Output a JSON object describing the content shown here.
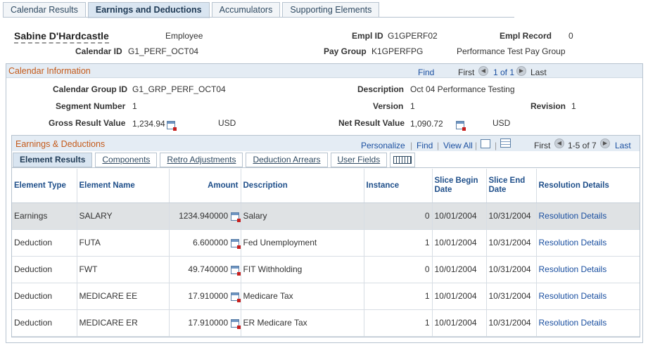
{
  "tabs": [
    "Calendar Results",
    "Earnings and Deductions",
    "Accumulators",
    "Supporting Elements"
  ],
  "header": {
    "employee_name": "Sabine D'Hardcastle",
    "employee_label": "Employee",
    "empl_id_label": "Empl ID",
    "empl_id": "G1GPERF02",
    "empl_record_label": "Empl Record",
    "empl_record": "0",
    "calendar_id_label": "Calendar ID",
    "calendar_id": "G1_PERF_OCT04",
    "pay_group_label": "Pay Group",
    "pay_group": "K1GPERFPG",
    "pay_group_desc": "Performance Test Pay Group"
  },
  "calendar_info": {
    "title": "Calendar Information",
    "find": "Find",
    "first": "First",
    "range": "1 of 1",
    "last": "Last",
    "calendar_group_id_label": "Calendar Group ID",
    "calendar_group_id": "G1_GRP_PERF_OCT04",
    "description_label": "Description",
    "description": "Oct 04 Performance Testing",
    "segment_number_label": "Segment Number",
    "segment_number": "1",
    "version_label": "Version",
    "version": "1",
    "revision_label": "Revision",
    "revision": "1",
    "gross_label": "Gross Result Value",
    "gross": "1,234.94",
    "gross_currency": "USD",
    "net_label": "Net Result Value",
    "net": "1,090.72",
    "net_currency": "USD"
  },
  "earnings": {
    "title": "Earnings & Deductions",
    "personalize": "Personalize",
    "find": "Find",
    "view_all": "View All",
    "first": "First",
    "range": "1-5 of 7",
    "last": "Last",
    "subtabs": [
      "Element Results",
      "Components",
      "Retro Adjustments",
      "Deduction Arrears",
      "User Fields"
    ],
    "columns": [
      "Element Type",
      "Element Name",
      "Amount",
      "Description",
      "Instance",
      "Slice Begin Date",
      "Slice End Date",
      "Resolution Details"
    ],
    "rows": [
      {
        "type": "Earnings",
        "name": "SALARY",
        "amount": "1234.940000",
        "description": "Salary",
        "instance": "0",
        "begin": "10/01/2004",
        "end": "10/31/2004",
        "resolution": "Resolution Details"
      },
      {
        "type": "Deduction",
        "name": "FUTA",
        "amount": "6.600000",
        "description": "Fed Unemployment",
        "instance": "1",
        "begin": "10/01/2004",
        "end": "10/31/2004",
        "resolution": "Resolution Details"
      },
      {
        "type": "Deduction",
        "name": "FWT",
        "amount": "49.740000",
        "description": "FIT Withholding",
        "instance": "0",
        "begin": "10/01/2004",
        "end": "10/31/2004",
        "resolution": "Resolution Details"
      },
      {
        "type": "Deduction",
        "name": "MEDICARE EE",
        "amount": "17.910000",
        "description": "Medicare Tax",
        "instance": "1",
        "begin": "10/01/2004",
        "end": "10/31/2004",
        "resolution": "Resolution Details"
      },
      {
        "type": "Deduction",
        "name": "MEDICARE ER",
        "amount": "17.910000",
        "description": "ER Medicare Tax",
        "instance": "1",
        "begin": "10/01/2004",
        "end": "10/31/2004",
        "resolution": "Resolution Details"
      }
    ]
  },
  "icons": {
    "calendar": "calculator-icon",
    "prev": "previous-arrow-icon",
    "next": "next-arrow-icon",
    "zoom": "zoom-icon",
    "grid": "grid-icon",
    "show_all_columns": "show-all-columns-icon"
  }
}
